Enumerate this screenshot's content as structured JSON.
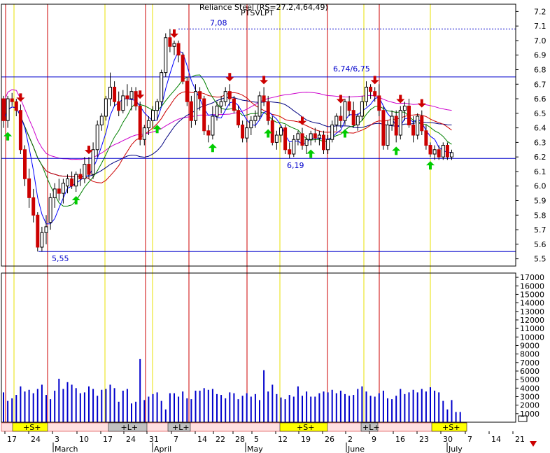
{
  "chart_data": {
    "type": "candlestick",
    "title_line1": "Reliance Steel (RS=27.2,4,64,49)",
    "title_line2": "PTSVLPT",
    "price_axis": {
      "ylim": [
        5.45,
        7.25
      ],
      "ticks": [
        "7.2",
        "7.1",
        "7.0",
        "6.9",
        "6.8",
        "6.7",
        "6.6",
        "6.5",
        "6.4",
        "6.3",
        "6.2",
        "6.1",
        "6.0",
        "5.9",
        "5.8",
        "5.7",
        "5.6",
        "5.5"
      ]
    },
    "volume_axis": {
      "ylim": [
        0,
        17500
      ],
      "ticks": [
        "17000",
        "16000",
        "15000",
        "14000",
        "13000",
        "12000",
        "11000",
        "10000",
        "9000",
        "8000",
        "7000",
        "6000",
        "5000",
        "4000",
        "3000",
        "2000",
        "1000"
      ]
    },
    "levels": [
      {
        "value": 6.75,
        "label": "6,74/6,75"
      },
      {
        "value": 6.19,
        "label": "6,19"
      },
      {
        "value": 5.55,
        "label": "5,55"
      },
      {
        "value": 7.08,
        "label": "7,08"
      }
    ],
    "date_labels": [
      "17",
      "24",
      "3",
      "10",
      "17",
      "24",
      "31",
      "7",
      "14",
      "22",
      "28",
      "5",
      "12",
      "19",
      "26",
      "2",
      "9",
      "16",
      "23",
      "30",
      "7",
      "14",
      "21"
    ],
    "month_labels": [
      "March",
      "April",
      "May",
      "June",
      "July"
    ],
    "status_segments": [
      {
        "label": "+S+",
        "type": "s"
      },
      {
        "label": "+L+",
        "type": "l"
      },
      {
        "label": "+L+",
        "type": "l"
      },
      {
        "label": "+S+",
        "type": "s"
      },
      {
        "label": "+L+",
        "type": "l"
      },
      {
        "label": "+S+",
        "type": "s"
      }
    ],
    "candles": [
      [
        6.6,
        6.62,
        6.4,
        6.45
      ],
      [
        6.45,
        6.62,
        6.4,
        6.6
      ],
      [
        6.6,
        6.64,
        6.55,
        6.58
      ],
      [
        6.58,
        6.6,
        6.48,
        6.52
      ],
      [
        6.52,
        6.56,
        6.22,
        6.25
      ],
      [
        6.25,
        6.28,
        6.0,
        6.05
      ],
      [
        6.05,
        6.12,
        5.85,
        5.92
      ],
      [
        5.92,
        5.98,
        5.75,
        5.8
      ],
      [
        5.8,
        5.82,
        5.55,
        5.58
      ],
      [
        5.58,
        5.72,
        5.55,
        5.68
      ],
      [
        5.68,
        5.8,
        5.6,
        5.72
      ],
      [
        5.75,
        5.95,
        5.7,
        5.92
      ],
      [
        5.92,
        6.02,
        5.85,
        5.98
      ],
      [
        5.98,
        6.05,
        5.9,
        5.95
      ],
      [
        5.95,
        6.05,
        5.88,
        6.02
      ],
      [
        6.0,
        6.08,
        5.95,
        6.05
      ],
      [
        6.05,
        6.1,
        5.98,
        6.0
      ],
      [
        6.0,
        6.1,
        5.96,
        6.08
      ],
      [
        6.08,
        6.12,
        6.0,
        6.05
      ],
      [
        6.05,
        6.2,
        6.02,
        6.15
      ],
      [
        6.15,
        6.2,
        6.05,
        6.08
      ],
      [
        6.08,
        6.3,
        6.05,
        6.25
      ],
      [
        6.25,
        6.45,
        6.2,
        6.42
      ],
      [
        6.42,
        6.5,
        6.38,
        6.48
      ],
      [
        6.48,
        6.62,
        6.45,
        6.6
      ],
      [
        6.6,
        6.78,
        6.55,
        6.68
      ],
      [
        6.68,
        6.72,
        6.55,
        6.58
      ],
      [
        6.58,
        6.65,
        6.48,
        6.52
      ],
      [
        6.52,
        6.66,
        6.5,
        6.62
      ],
      [
        6.62,
        6.7,
        6.55,
        6.6
      ],
      [
        6.6,
        6.68,
        6.52,
        6.65
      ],
      [
        6.65,
        6.68,
        6.52,
        6.55
      ],
      [
        6.55,
        6.58,
        6.28,
        6.32
      ],
      [
        6.32,
        6.42,
        6.28,
        6.4
      ],
      [
        6.4,
        6.48,
        6.35,
        6.45
      ],
      [
        6.45,
        6.55,
        6.4,
        6.52
      ],
      [
        6.52,
        6.6,
        6.45,
        6.58
      ],
      [
        6.58,
        6.8,
        6.55,
        6.78
      ],
      [
        6.78,
        7.05,
        6.75,
        7.02
      ],
      [
        7.02,
        7.08,
        6.92,
        6.96
      ],
      [
        6.96,
        7.0,
        6.9,
        6.98
      ],
      [
        6.98,
        7.0,
        6.85,
        6.9
      ],
      [
        6.9,
        6.92,
        6.7,
        6.72
      ],
      [
        6.72,
        6.75,
        6.55,
        6.58
      ],
      [
        6.58,
        6.62,
        6.4,
        6.45
      ],
      [
        6.45,
        6.7,
        6.42,
        6.65
      ],
      [
        6.65,
        6.68,
        6.52,
        6.6
      ],
      [
        6.6,
        6.62,
        6.35,
        6.38
      ],
      [
        6.38,
        6.42,
        6.3,
        6.35
      ],
      [
        6.35,
        6.55,
        6.32,
        6.48
      ],
      [
        6.48,
        6.58,
        6.45,
        6.55
      ],
      [
        6.55,
        6.62,
        6.5,
        6.58
      ],
      [
        6.58,
        6.68,
        6.55,
        6.65
      ],
      [
        6.65,
        6.7,
        6.55,
        6.6
      ],
      [
        6.6,
        6.62,
        6.5,
        6.52
      ],
      [
        6.52,
        6.55,
        6.4,
        6.42
      ],
      [
        6.42,
        6.45,
        6.3,
        6.33
      ],
      [
        6.33,
        6.45,
        6.3,
        6.4
      ],
      [
        6.4,
        6.48,
        6.35,
        6.45
      ],
      [
        6.45,
        6.52,
        6.4,
        6.48
      ],
      [
        6.48,
        6.65,
        6.45,
        6.62
      ],
      [
        6.62,
        6.68,
        6.55,
        6.58
      ],
      [
        6.58,
        6.62,
        6.42,
        6.45
      ],
      [
        6.45,
        6.48,
        6.28,
        6.3
      ],
      [
        6.3,
        6.38,
        6.25,
        6.35
      ],
      [
        6.35,
        6.42,
        6.3,
        6.4
      ],
      [
        6.4,
        6.42,
        6.22,
        6.25
      ],
      [
        6.25,
        6.3,
        6.19,
        6.22
      ],
      [
        6.22,
        6.35,
        6.2,
        6.32
      ],
      [
        6.32,
        6.38,
        6.28,
        6.36
      ],
      [
        6.36,
        6.4,
        6.25,
        6.28
      ],
      [
        6.28,
        6.35,
        6.22,
        6.32
      ],
      [
        6.32,
        6.38,
        6.28,
        6.36
      ],
      [
        6.36,
        6.4,
        6.3,
        6.33
      ],
      [
        6.33,
        6.38,
        6.28,
        6.35
      ],
      [
        6.35,
        6.38,
        6.22,
        6.25
      ],
      [
        6.25,
        6.35,
        6.22,
        6.32
      ],
      [
        6.32,
        6.45,
        6.3,
        6.42
      ],
      [
        6.42,
        6.5,
        6.38,
        6.48
      ],
      [
        6.48,
        6.55,
        6.4,
        6.45
      ],
      [
        6.45,
        6.6,
        6.42,
        6.58
      ],
      [
        6.58,
        6.62,
        6.48,
        6.52
      ],
      [
        6.52,
        6.58,
        6.4,
        6.42
      ],
      [
        6.42,
        6.5,
        6.38,
        6.48
      ],
      [
        6.48,
        6.62,
        6.45,
        6.58
      ],
      [
        6.58,
        6.72,
        6.55,
        6.68
      ],
      [
        6.68,
        6.7,
        6.6,
        6.65
      ],
      [
        6.65,
        6.68,
        6.58,
        6.62
      ],
      [
        6.62,
        6.7,
        6.48,
        6.52
      ],
      [
        6.52,
        6.55,
        6.25,
        6.28
      ],
      [
        6.28,
        6.45,
        6.25,
        6.42
      ],
      [
        6.42,
        6.52,
        6.38,
        6.48
      ],
      [
        6.48,
        6.52,
        6.3,
        6.35
      ],
      [
        6.35,
        6.55,
        6.32,
        6.52
      ],
      [
        6.52,
        6.58,
        6.45,
        6.55
      ],
      [
        6.55,
        6.6,
        6.4,
        6.42
      ],
      [
        6.42,
        6.48,
        6.3,
        6.35
      ],
      [
        6.35,
        6.5,
        6.32,
        6.48
      ],
      [
        6.48,
        6.52,
        6.35,
        6.38
      ],
      [
        6.38,
        6.42,
        6.25,
        6.28
      ],
      [
        6.28,
        6.3,
        6.2,
        6.22
      ],
      [
        6.22,
        6.28,
        6.18,
        6.25
      ],
      [
        6.25,
        6.28,
        6.18,
        6.2
      ],
      [
        6.2,
        6.3,
        6.18,
        6.28
      ],
      [
        6.28,
        6.3,
        6.18,
        6.2
      ],
      [
        6.2,
        6.25,
        6.18,
        6.23
      ]
    ],
    "volumes": [
      3500,
      2500,
      2800,
      3200,
      4200,
      3600,
      3800,
      3400,
      3900,
      4400,
      3200,
      2700,
      3700,
      5100,
      3900,
      4700,
      4400,
      4000,
      3400,
      3500,
      4200,
      3900,
      3100,
      3800,
      3900,
      4400,
      4000,
      2400,
      3700,
      3900,
      2200,
      2400,
      7400,
      2600,
      3000,
      3300,
      3500,
      2500,
      1500,
      3400,
      3400,
      3000,
      3600,
      2800,
      2700,
      3700,
      3700,
      4000,
      3800,
      3900,
      3300,
      3200,
      2800,
      3500,
      3400,
      2700,
      3100,
      3400,
      3000,
      3300,
      2600,
      6100,
      3600,
      4400,
      3300,
      2900,
      2700,
      3200,
      3000,
      4200,
      3100,
      3600,
      3000,
      3000,
      3400,
      3600,
      3500,
      3800,
      3400,
      3700,
      3300,
      3100,
      3200,
      3900,
      4200,
      3600,
      3100,
      3000,
      3400,
      3700,
      2800,
      2700,
      3100,
      3900,
      3300,
      3500,
      3800,
      3500,
      3900,
      3600,
      4100,
      3700,
      3500,
      2500,
      1500,
      2600,
      1200,
      1200
    ],
    "up_arrows": [
      1,
      17,
      36,
      49,
      62,
      72,
      80,
      92,
      100
    ],
    "down_arrows": [
      4,
      20,
      32,
      40,
      53,
      61,
      70,
      79,
      87,
      93,
      98
    ],
    "series": [
      {
        "color": "#cc00cc"
      },
      {
        "color": "#000080"
      },
      {
        "color": "#cc0000"
      },
      {
        "color": "#008000"
      },
      {
        "color": "#0000ff"
      }
    ]
  }
}
